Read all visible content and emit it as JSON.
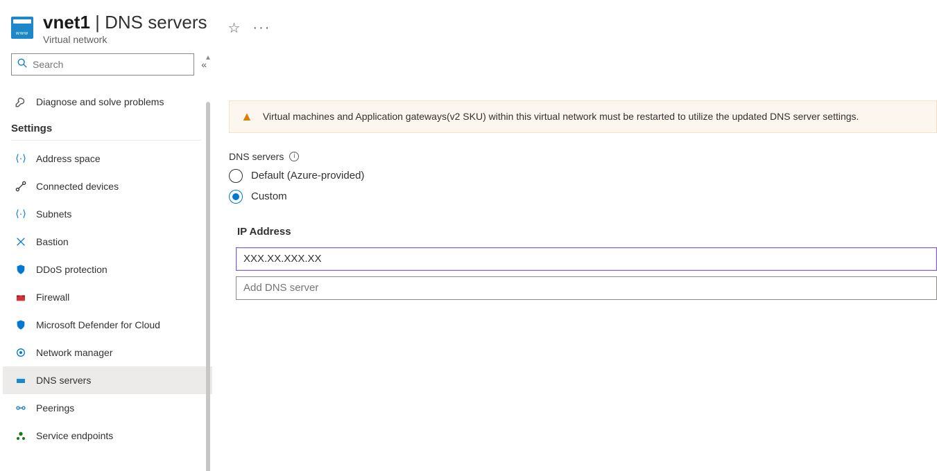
{
  "header": {
    "resource_name": "vnet1",
    "separator": " | ",
    "blade_name": "DNS servers",
    "subtitle": "Virtual network"
  },
  "sidebar": {
    "search_placeholder": "Search",
    "top_item": {
      "label": "Diagnose and solve problems"
    },
    "section_title": "Settings",
    "items": [
      {
        "label": "Address space",
        "icon": "address-space-icon",
        "color": "c-blue"
      },
      {
        "label": "Connected devices",
        "icon": "connected-devices-icon",
        "color": ""
      },
      {
        "label": "Subnets",
        "icon": "subnets-icon",
        "color": "c-blue"
      },
      {
        "label": "Bastion",
        "icon": "bastion-icon",
        "color": "c-blue"
      },
      {
        "label": "DDoS protection",
        "icon": "ddos-icon",
        "color": "c-blue"
      },
      {
        "label": "Firewall",
        "icon": "firewall-icon",
        "color": "c-red"
      },
      {
        "label": "Microsoft Defender for Cloud",
        "icon": "defender-icon",
        "color": "c-blue"
      },
      {
        "label": "Network manager",
        "icon": "network-manager-icon",
        "color": "c-blue"
      },
      {
        "label": "DNS servers",
        "icon": "dns-icon",
        "color": "c-blue",
        "selected": true
      },
      {
        "label": "Peerings",
        "icon": "peerings-icon",
        "color": "c-blue"
      },
      {
        "label": "Service endpoints",
        "icon": "service-endpoints-icon",
        "color": "c-green"
      }
    ]
  },
  "main": {
    "warning": "Virtual machines and Application gateways(v2 SKU) within this virtual network must be restarted to utilize the updated DNS server settings.",
    "field_label": "DNS servers",
    "options": {
      "default": "Default (Azure-provided)",
      "custom": "Custom"
    },
    "ip_heading": "IP Address",
    "ip_value": "XXX.XX.XXX.XX",
    "ip_placeholder": "Add DNS server"
  }
}
